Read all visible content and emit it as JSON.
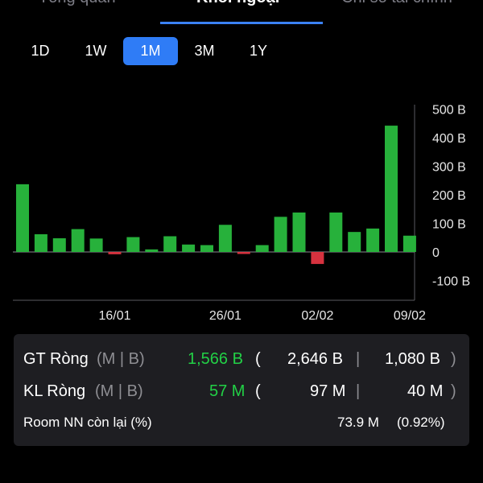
{
  "tabs": [
    {
      "label": "Tổng quan",
      "active": false
    },
    {
      "label": "Khối ngoại",
      "active": true
    },
    {
      "label": "Chỉ số tài chính",
      "active": false
    }
  ],
  "ranges": [
    {
      "label": "1D",
      "active": false
    },
    {
      "label": "1W",
      "active": false
    },
    {
      "label": "1M",
      "active": true
    },
    {
      "label": "3M",
      "active": false
    },
    {
      "label": "1Y",
      "active": false
    }
  ],
  "colors": {
    "accent": "#2f7cf6",
    "positive": "#27b13b",
    "negative": "#d7323f",
    "positive_text": "#22d046"
  },
  "chart_data": {
    "type": "bar",
    "unit": "B",
    "values": [
      237,
      62,
      48,
      80,
      47,
      -8,
      52,
      9,
      55,
      26,
      24,
      95,
      -7,
      24,
      123,
      138,
      -42,
      138,
      70,
      82,
      442,
      57
    ],
    "y_ticks": [
      500,
      400,
      300,
      200,
      100,
      0,
      -100
    ],
    "y_tick_labels": [
      "500 B",
      "400 B",
      "300 B",
      "200 B",
      "100 B",
      "0",
      "-100 B"
    ],
    "x_tick_labels": [
      {
        "label": "16/01",
        "bar_index": 5
      },
      {
        "label": "26/01",
        "bar_index": 11
      },
      {
        "label": "02/02",
        "bar_index": 16
      },
      {
        "label": "09/02",
        "bar_index": 21
      }
    ],
    "ylim": [
      -130,
      560
    ],
    "grid": false
  },
  "summary": {
    "gt": {
      "label": "GT Ròng",
      "unit": "(M | B)",
      "net": "1,566 B",
      "open": "(",
      "buy": "2,646 B",
      "sep": "|",
      "sell": "1,080 B",
      "close": ")"
    },
    "kl": {
      "label": "KL Ròng",
      "unit": "(M | B)",
      "net": "57 M",
      "open": "(",
      "buy": "97 M",
      "sep": "|",
      "sell": "40 M",
      "close": ")"
    },
    "room": {
      "label": "Room NN còn lại (%)",
      "value": "73.9 M",
      "percent": "(0.92%)"
    }
  }
}
